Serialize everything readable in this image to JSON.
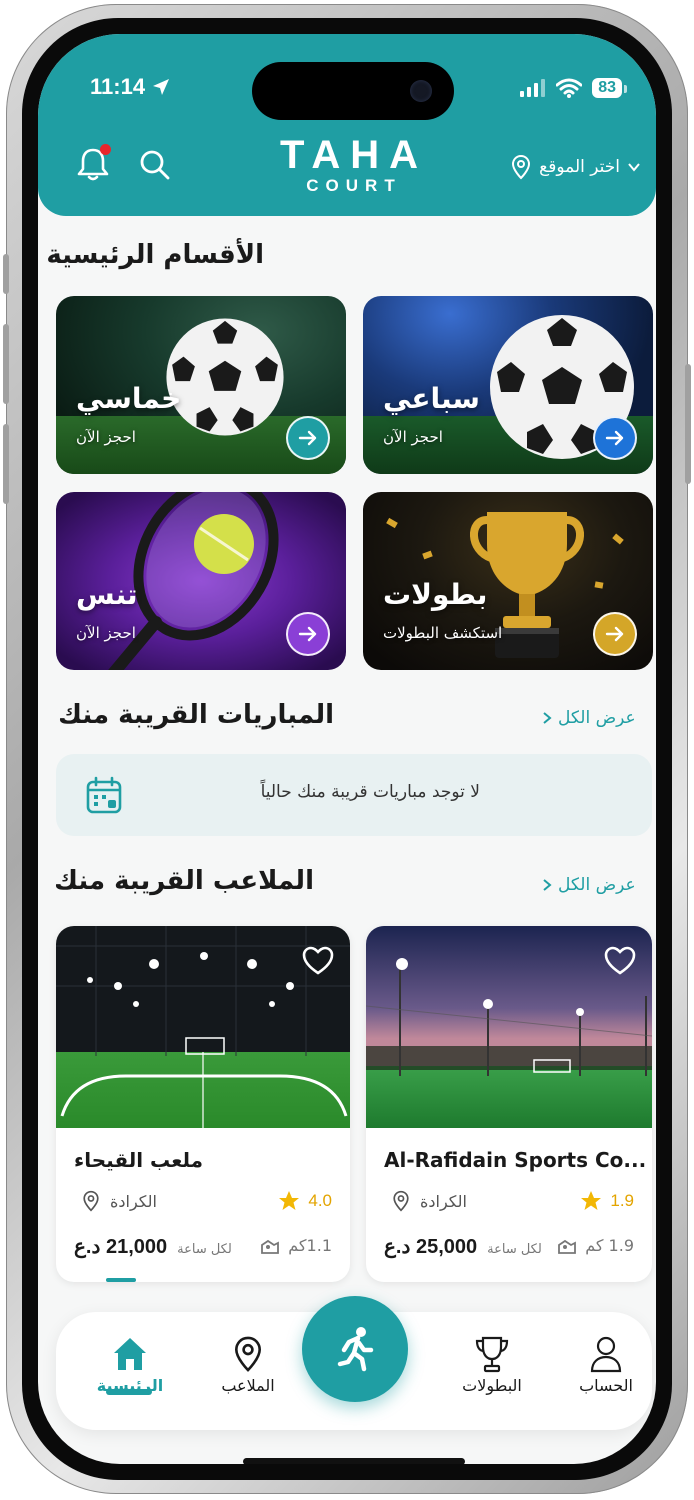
{
  "status": {
    "time": "11:14",
    "battery": "83"
  },
  "header": {
    "logo_line1": "TAHA",
    "logo_line2": "COURT",
    "location_label": "اختر الموقع"
  },
  "main_categories": {
    "title": "الأقسام الرئيسية",
    "items": [
      {
        "name": "سباعي",
        "action": "احجز الآن",
        "accent": "#1e73d8"
      },
      {
        "name": "خماسي",
        "action": "احجز الآن",
        "accent": "#1f9ea3"
      },
      {
        "name": "بطولات",
        "action": "استكشف البطولات",
        "accent": "#d4a628"
      },
      {
        "name": "تنس",
        "action": "احجز الآن",
        "accent": "#8a3fd6"
      }
    ]
  },
  "nearby_matches": {
    "title": "المباريات القريبة منك",
    "see_all": "عرض الكل",
    "empty_text": "لا توجد مباريات قريبة منك حالياً"
  },
  "nearby_venues": {
    "title": "الملاعب القريبة منك",
    "see_all": "عرض الكل",
    "items": [
      {
        "name": "Al-Rafidain Sports Co...",
        "rating": "1.9",
        "area": "الكرادة",
        "distance": "1.9 كم",
        "price": "25,000 د.ع",
        "per": "لكل ساعة"
      },
      {
        "name": "ملعب القيحاء",
        "rating": "4.0",
        "area": "الكرادة",
        "distance": "1.1كم",
        "price": "21,000 د.ع",
        "per": "لكل ساعة"
      }
    ]
  },
  "bottom_nav": {
    "account": "الحساب",
    "tournaments": "البطولات",
    "fields": "الملاعب",
    "home": "الرئيسية"
  },
  "colors": {
    "brand": "#1f9ea3",
    "star": "#f2b705"
  }
}
